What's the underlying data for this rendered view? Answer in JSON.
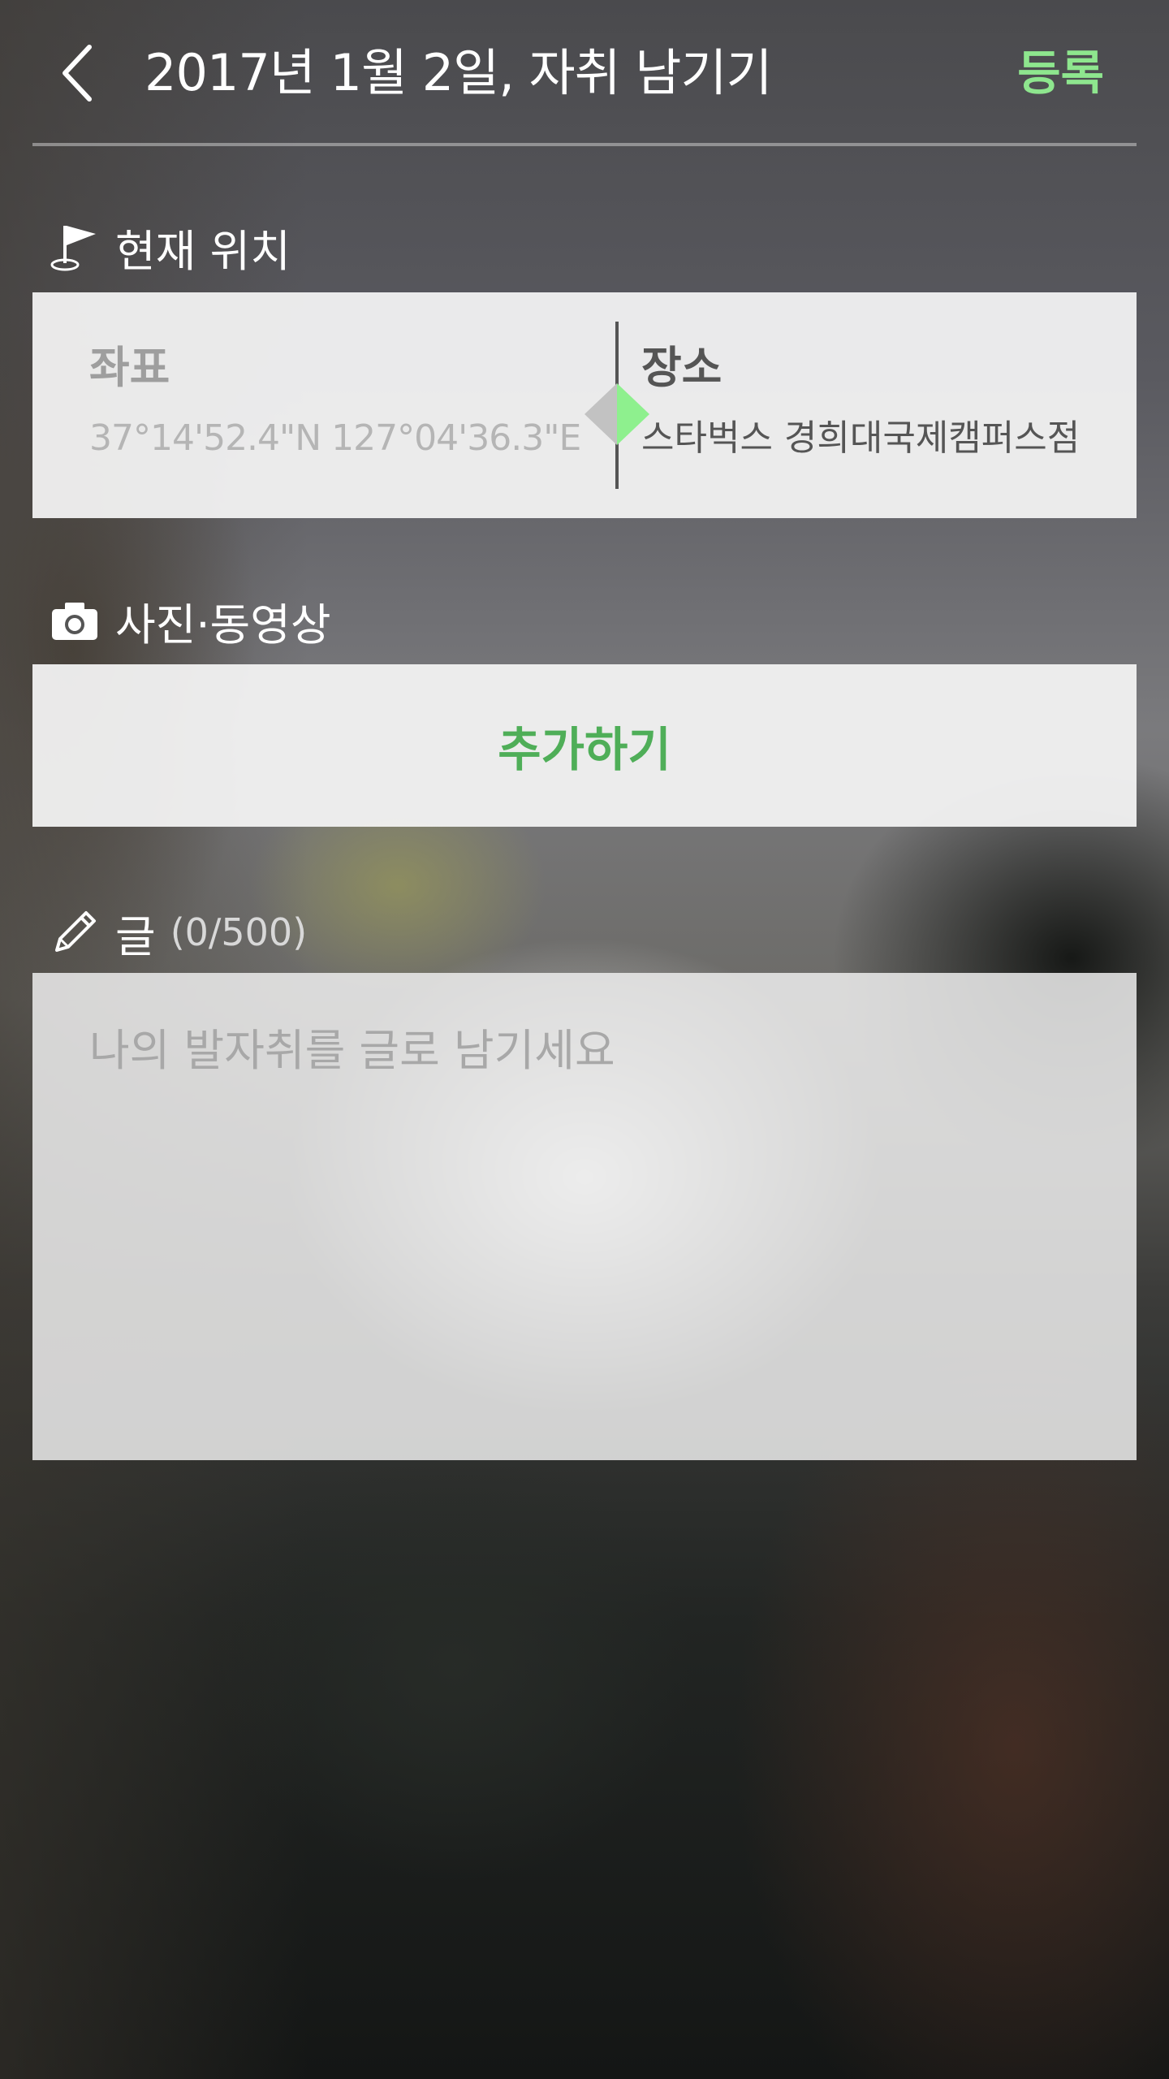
{
  "header": {
    "back_icon": "chevron-left-icon",
    "title": "2017년 1월 2일, 자취 남기기",
    "register_label": "등록"
  },
  "location": {
    "section_label": "현재 위치",
    "section_icon": "flag-icon",
    "coords_title": "좌표",
    "coords_value": "37°14'52.4\"N 127°04'36.3\"E",
    "place_title": "장소",
    "place_value": "스타벅스 경희대국제캠퍼스점",
    "selected_mode": "장소"
  },
  "media": {
    "section_label": "사진·동영상",
    "section_icon": "camera-icon",
    "add_label": "추가하기"
  },
  "text": {
    "section_label": "글",
    "count": "(0/500)",
    "section_icon": "pencil-icon",
    "placeholder": "나의 발자취를 글로 남기세요",
    "value": ""
  },
  "colors": {
    "accent": "#4fae58",
    "header_accent": "#8ee68e",
    "switch_active": "#8ef08e",
    "switch_inactive": "#c2c2c2"
  }
}
